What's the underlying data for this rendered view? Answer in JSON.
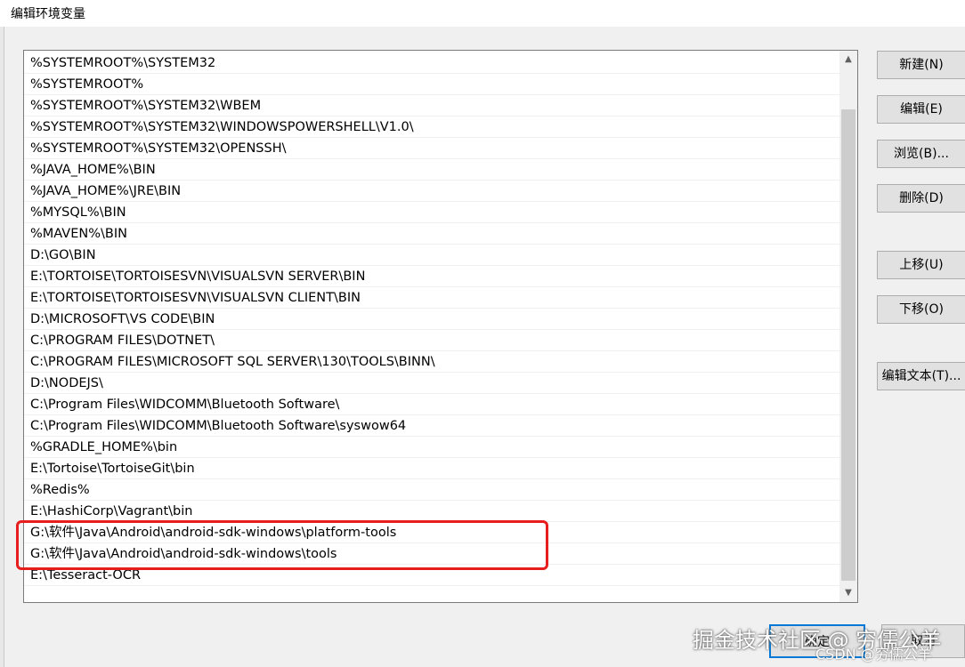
{
  "window": {
    "title": "编辑环境变量"
  },
  "paths": [
    "%SYSTEMROOT%\\SYSTEM32",
    "%SYSTEMROOT%",
    "%SYSTEMROOT%\\SYSTEM32\\WBEM",
    "%SYSTEMROOT%\\SYSTEM32\\WINDOWSPOWERSHELL\\V1.0\\",
    "%SYSTEMROOT%\\SYSTEM32\\OPENSSH\\",
    "%JAVA_HOME%\\BIN",
    "%JAVA_HOME%\\JRE\\BIN",
    "%MYSQL%\\BIN",
    "%MAVEN%\\BIN",
    "D:\\GO\\BIN",
    "E:\\TORTOISE\\TORTOISESVN\\VISUALSVN SERVER\\BIN",
    "E:\\TORTOISE\\TORTOISESVN\\VISUALSVN CLIENT\\BIN",
    "D:\\MICROSOFT\\VS CODE\\BIN",
    "C:\\PROGRAM FILES\\DOTNET\\",
    "C:\\PROGRAM FILES\\MICROSOFT SQL SERVER\\130\\TOOLS\\BINN\\",
    "D:\\NODEJS\\",
    "C:\\Program Files\\WIDCOMM\\Bluetooth Software\\",
    "C:\\Program Files\\WIDCOMM\\Bluetooth Software\\syswow64",
    "%GRADLE_HOME%\\bin",
    "E:\\Tortoise\\TortoiseGit\\bin",
    "%Redis%",
    "E:\\HashiCorp\\Vagrant\\bin",
    "G:\\软件\\Java\\Android\\android-sdk-windows\\platform-tools",
    "G:\\软件\\Java\\Android\\android-sdk-windows\\tools",
    "E:\\Tesseract-OCR"
  ],
  "buttons": {
    "new": "新建(N)",
    "edit": "编辑(E)",
    "browse": "浏览(B)...",
    "delete": "删除(D)",
    "move_up": "上移(U)",
    "move_down": "下移(O)",
    "edit_text": "编辑文本(T)...",
    "ok": "确定",
    "cancel": "取消"
  },
  "watermark": {
    "main": "掘金技术社区 @ 穷儒公羊",
    "small": "CSDN @穷儒公羊"
  },
  "colors": {
    "highlight": "#e81e1e",
    "focus": "#0078d7"
  }
}
